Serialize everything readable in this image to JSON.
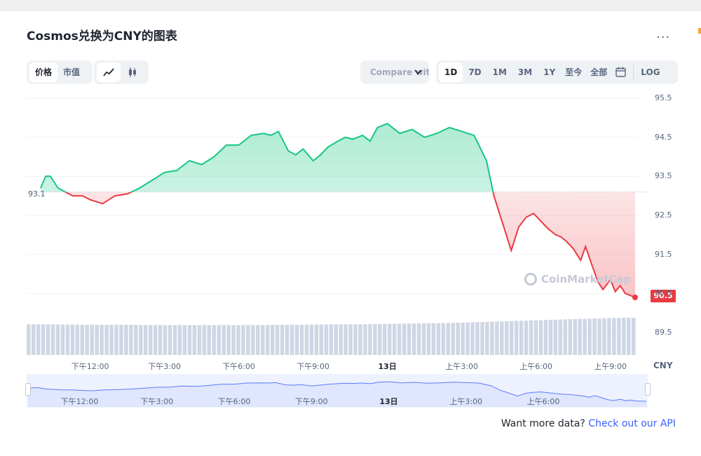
{
  "title": "Cosmos兑换为CNY的图表",
  "more_label": "...",
  "toolbar": {
    "type_tabs": [
      "价格",
      "市值"
    ],
    "view_icons": [
      "line-chart-icon",
      "candlestick-icon"
    ],
    "compare_label": "Compare with",
    "range_tabs": [
      "1D",
      "7D",
      "1M",
      "3M",
      "1Y",
      "至今",
      "全部"
    ],
    "calendar_icon": "calendar-icon",
    "log_label": "LOG",
    "active_range": "1D",
    "active_type": "价格"
  },
  "colors": {
    "up": "#16c784",
    "down": "#ea3943",
    "accent": "#3861fb"
  },
  "current_price_label": "90.5",
  "reference_label": "93.1",
  "currency": "CNY",
  "watermark": "CoinMarketCap",
  "api_prompt": {
    "text": "Want more data?",
    "link": "Check out our API"
  },
  "chart_data": {
    "type": "line",
    "reference_value": 93.1,
    "ylim": [
      89.5,
      95.5
    ],
    "yticks": [
      95.5,
      94.5,
      93.5,
      92.5,
      91.5,
      90.5,
      89.5
    ],
    "x_tick_labels": [
      "下午12:00",
      "下午3:00",
      "下午6:00",
      "下午9:00",
      "13日",
      "上午3:00",
      "上午6:00",
      "上午9:00"
    ],
    "navigator_tick_labels": [
      "下午12:00",
      "下午3:00",
      "下午6:00",
      "下午9:00",
      "13日",
      "上午3:00",
      "上午6:00"
    ],
    "x_unit": "hours since chart start",
    "x_range": [
      0,
      24
    ],
    "x_tick_positions": [
      2.0,
      5.0,
      8.0,
      11.0,
      14.0,
      17.0,
      20.0,
      23.0
    ],
    "series": [
      {
        "x": [
          0,
          0.2,
          0.4,
          0.7,
          1.0,
          1.3,
          1.7,
          2.0,
          2.5,
          3.0,
          3.5,
          4.0,
          4.5,
          5.0,
          5.5,
          6.0,
          6.5,
          7.0,
          7.5,
          8.0,
          8.5,
          9.0,
          9.3,
          9.6,
          10.0,
          10.3,
          10.6,
          11.0,
          11.3,
          11.6,
          12.0,
          12.3,
          12.6,
          13.0,
          13.3,
          13.6,
          14.0,
          14.5,
          15.0,
          15.5,
          16.0,
          16.5,
          17.0,
          17.5,
          18.0,
          18.3,
          18.6,
          19.0,
          19.3,
          19.6,
          19.9,
          20.2,
          20.5,
          20.8,
          21.0,
          21.2,
          21.5,
          21.8,
          22.0,
          22.3,
          22.5,
          22.7,
          23.0,
          23.2,
          23.4,
          23.6,
          23.8,
          24.0
        ],
        "values": [
          93.2,
          93.5,
          93.5,
          93.2,
          93.1,
          93.0,
          93.0,
          92.9,
          92.8,
          93.0,
          93.05,
          93.2,
          93.4,
          93.6,
          93.65,
          93.9,
          93.8,
          94.0,
          94.3,
          94.3,
          94.55,
          94.6,
          94.55,
          94.65,
          94.15,
          94.05,
          94.2,
          93.9,
          94.05,
          94.25,
          94.4,
          94.5,
          94.45,
          94.55,
          94.4,
          94.75,
          94.85,
          94.6,
          94.7,
          94.5,
          94.6,
          94.75,
          94.65,
          94.55,
          93.9,
          93.0,
          92.4,
          91.6,
          92.2,
          92.45,
          92.55,
          92.35,
          92.15,
          92.0,
          91.95,
          91.85,
          91.65,
          91.35,
          91.7,
          91.15,
          90.8,
          90.6,
          90.85,
          90.55,
          90.7,
          90.5,
          90.45,
          90.4
        ]
      }
    ],
    "volume": [
      0.78,
      0.78,
      0.77,
      0.77,
      0.77,
      0.76,
      0.76,
      0.76,
      0.76,
      0.76,
      0.77,
      0.77,
      0.78,
      0.78,
      0.79,
      0.8,
      0.81,
      0.82,
      0.84,
      0.86,
      0.88,
      0.9,
      0.92,
      0.94,
      0.95
    ]
  }
}
